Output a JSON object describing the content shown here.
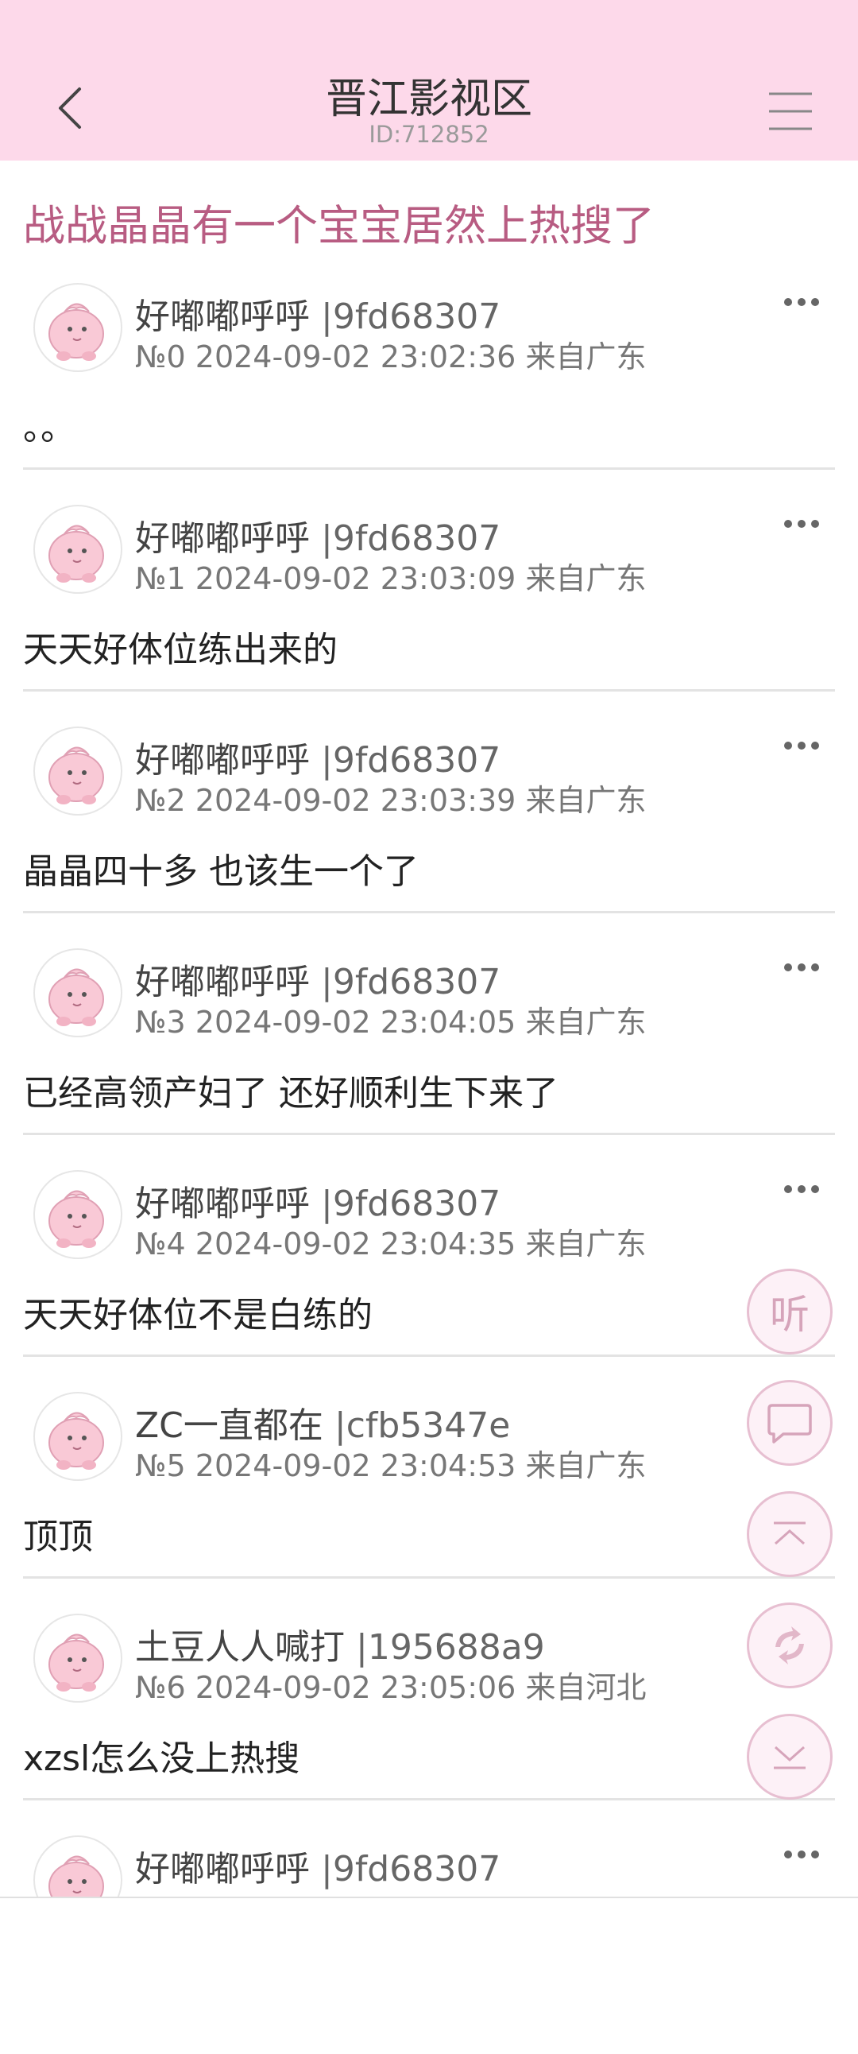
{
  "header": {
    "title": "晋江影视区",
    "id_text": "ID:712852",
    "back_icon": "chevron-left-icon",
    "menu_icon": "hamburger-menu-icon",
    "background": "#fdd9ea"
  },
  "thread": {
    "title": "战战晶晶有一个宝宝居然上热搜了",
    "title_color": "#b85c82"
  },
  "posts": [
    {
      "name": "好嘟嘟呼呼",
      "uid": "|9fd68307",
      "meta": "№0 2024-09-02 23:02:36 来自广东",
      "content": "。。",
      "has_more": true
    },
    {
      "name": "好嘟嘟呼呼",
      "uid": "|9fd68307",
      "meta": "№1 2024-09-02 23:03:09 来自广东",
      "content": "天天好体位练出来的",
      "has_more": true
    },
    {
      "name": "好嘟嘟呼呼",
      "uid": "|9fd68307",
      "meta": "№2 2024-09-02 23:03:39 来自广东",
      "content": "晶晶四十多 也该生一个了",
      "has_more": true
    },
    {
      "name": "好嘟嘟呼呼",
      "uid": "|9fd68307",
      "meta": "№3 2024-09-02 23:04:05 来自广东",
      "content": "已经高领产妇了 还好顺利生下来了",
      "has_more": true
    },
    {
      "name": "好嘟嘟呼呼",
      "uid": "|9fd68307",
      "meta": "№4 2024-09-02 23:04:35 来自广东",
      "content": "天天好体位不是白练的",
      "has_more": true
    },
    {
      "name": "ZC一直都在",
      "uid": "|cfb5347e",
      "meta": "№5 2024-09-02 23:04:53 来自广东",
      "content": "顶顶",
      "has_more": false
    },
    {
      "name": "土豆人人喊打",
      "uid": "|195688a9",
      "meta": "№6 2024-09-02 23:05:06 来自河北",
      "content": "xzsl怎么没上热搜",
      "has_more": false
    },
    {
      "name": "好嘟嘟呼呼",
      "uid": "|9fd68307",
      "meta": "",
      "content": "",
      "has_more": true
    }
  ],
  "fab": {
    "listen_label": "听",
    "comment_icon": "comment-bubble-icon",
    "top_icon": "scroll-to-top-icon",
    "refresh_icon": "refresh-arrows-icon",
    "bottom_icon": "scroll-to-bottom-icon"
  }
}
